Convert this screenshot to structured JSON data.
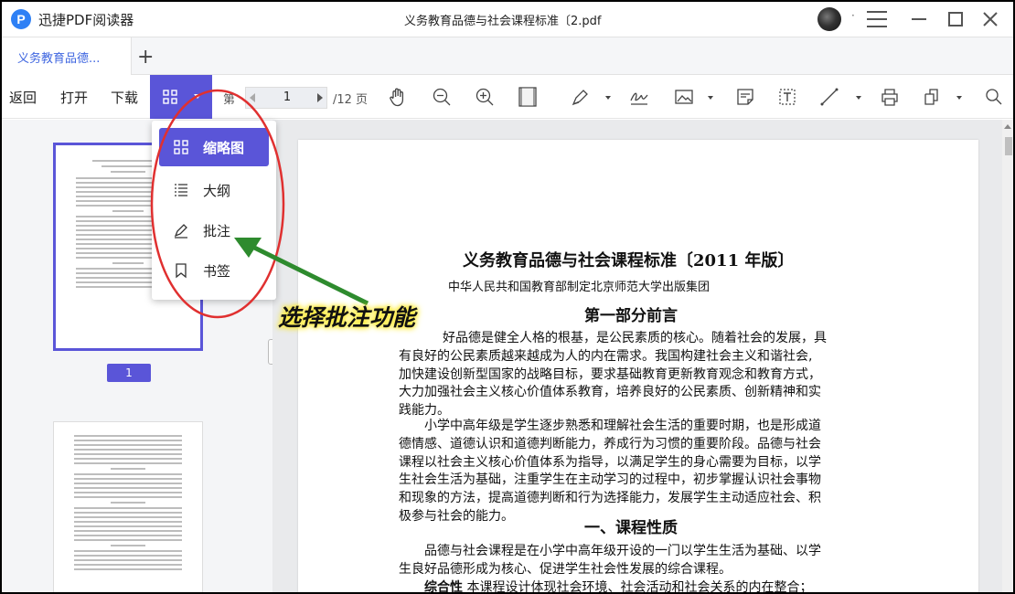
{
  "titlebar": {
    "logo_letter": "P",
    "app_name": "迅捷PDF阅读器",
    "doc_title": "义务教育品德与社会课程标准〔2.pdf"
  },
  "tabs": {
    "items": [
      {
        "label": "义务教育品德..."
      }
    ],
    "add_label": "+"
  },
  "toolbar": {
    "back": "返回",
    "open": "打开",
    "download": "下载",
    "page_prefix": "第",
    "current_page": "1",
    "page_total": "/12 页"
  },
  "view_menu": {
    "items": [
      {
        "label": "缩略图",
        "icon": "thumbnail-grid-icon",
        "active": true
      },
      {
        "label": "大纲",
        "icon": "outline-list-icon",
        "active": false
      },
      {
        "label": "批注",
        "icon": "pen-annotate-icon",
        "active": false
      },
      {
        "label": "书签",
        "icon": "bookmark-icon",
        "active": false
      }
    ]
  },
  "sidebar": {
    "page_badge": "1"
  },
  "annotation": {
    "callout": "选择批注功能",
    "highlight_color": "#e03030",
    "arrow_color": "#2e8b2e",
    "callout_glow": "#ffe600"
  },
  "colors": {
    "accent": "#5a55d8",
    "tab_text": "#3f66e0"
  },
  "document": {
    "title": "义务教育品德与社会课程标准〔2011 年版〕",
    "publisher": "中华人民共和国教育部制定北京师范大学出版集团",
    "section1": "第一部分前言",
    "para1_lines": [
      "好品德是健全人格的根基，是公民素质的核心。随着社会的发展，具",
      "有良好的公民素质越来越成为人的内在需求。我国构建社会主义和谐社会,",
      "加快建设创新型国家的战略目标，要求基础教育更新教育观念和教育方式，",
      "大力加强社会主义核心价值体系教育，培养良好的公民素质、创新精神和实",
      "践能力。"
    ],
    "para2_lines": [
      "小学中高年级是学生逐步熟悉和理解社会生活的重要时期，也是形成道",
      "德情感、道德认识和道德判断能力，养成行为习惯的重要阶段。品德与社会",
      "课程以社会主义核心价值体系为指导，以满足学生的身心需要为目标，以学",
      "生社会生活为基础，注重学生在主动学习的过程中，初步掌握认识社会事物",
      "和现象的方法，提高道德判断和行为选择能力，发展学生主动适应社会、积",
      "极参与社会的能力。"
    ],
    "section2": "一、课程性质",
    "para3_lines": [
      "品德与社会课程是在小学中高年级开设的一门以学生生活为基础、以学",
      "生良好品德形成为核心、促进学生社会性发展的综合课程。"
    ],
    "para3_bold": "综合性",
    "para3_tail": " 本课程设计体现社会环境、社会活动和社会关系的内在整合；"
  }
}
